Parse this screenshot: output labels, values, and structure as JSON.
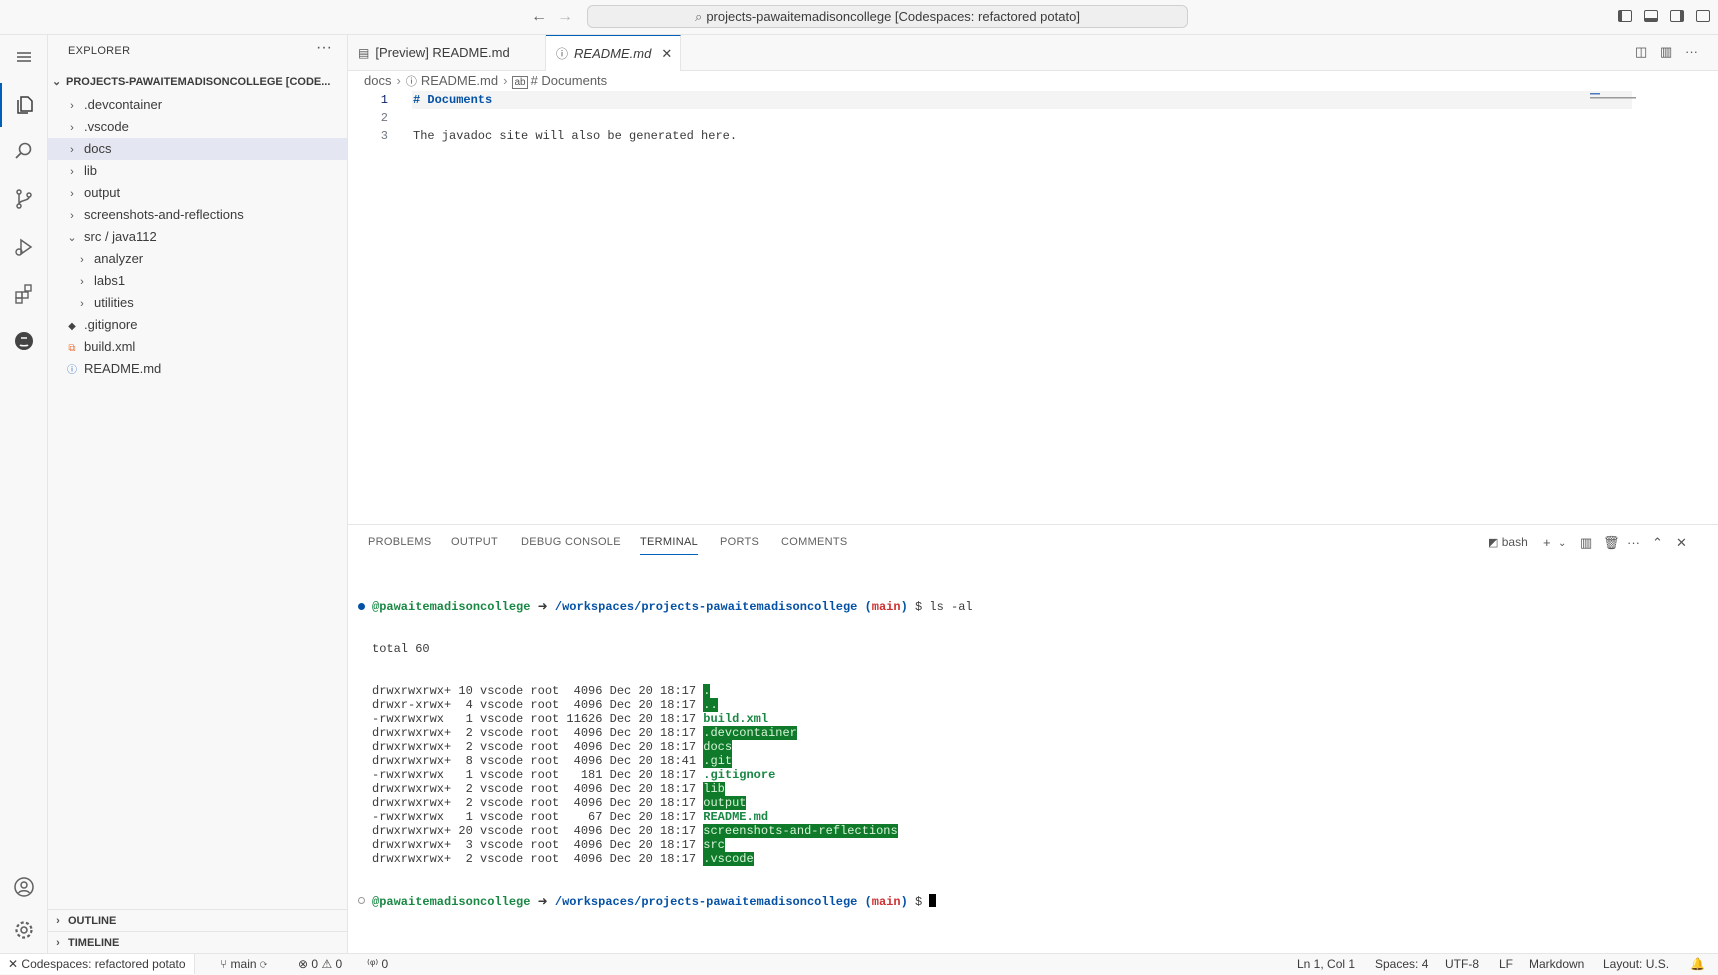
{
  "titlebar": {
    "command_center": "projects-pawaitemadisoncollege [Codespaces: refactored potato]"
  },
  "sidebar": {
    "title": "EXPLORER",
    "root": "PROJECTS-PAWAITEMADISONCOLLEGE [CODE...",
    "items": [
      {
        "label": ".devcontainer",
        "type": "folder",
        "expanded": false
      },
      {
        "label": ".vscode",
        "type": "folder",
        "expanded": false
      },
      {
        "label": "docs",
        "type": "folder",
        "expanded": false,
        "selected": true
      },
      {
        "label": "lib",
        "type": "folder",
        "expanded": false
      },
      {
        "label": "output",
        "type": "folder",
        "expanded": false
      },
      {
        "label": "screenshots-and-reflections",
        "type": "folder",
        "expanded": false
      },
      {
        "label": "src / java112",
        "type": "folder",
        "expanded": true
      },
      {
        "label": "analyzer",
        "type": "folder",
        "expanded": false,
        "indent": 1
      },
      {
        "label": "labs1",
        "type": "folder",
        "expanded": false,
        "indent": 1
      },
      {
        "label": "utilities",
        "type": "folder",
        "expanded": false,
        "indent": 1
      },
      {
        "label": ".gitignore",
        "type": "file",
        "icon": "git-icon"
      },
      {
        "label": "build.xml",
        "type": "file",
        "icon": "rss-icon"
      },
      {
        "label": "README.md",
        "type": "file",
        "icon": "info-icon"
      }
    ],
    "outline": "OUTLINE",
    "timeline": "TIMELINE"
  },
  "tabs": [
    {
      "label": "[Preview] README.md",
      "active": false
    },
    {
      "label": "README.md",
      "active": true
    }
  ],
  "breadcrumb": [
    "docs",
    "README.md",
    "# Documents"
  ],
  "editor": {
    "lines": [
      {
        "num": "1",
        "text": "# Documents"
      },
      {
        "num": "2",
        "text": ""
      },
      {
        "num": "3",
        "text": "The javadoc site will also be generated here."
      }
    ]
  },
  "panel": {
    "tabs": [
      "PROBLEMS",
      "OUTPUT",
      "DEBUG CONSOLE",
      "TERMINAL",
      "PORTS",
      "COMMENTS"
    ],
    "active_tab": "TERMINAL",
    "shell": "bash",
    "prompt": {
      "user": "@pawaitemadisoncollege",
      "arrow": "➜",
      "path": "/workspaces/projects-pawaitemadisoncollege",
      "branch_open": "(",
      "branch": "main",
      "branch_close": ")",
      "dollar": "$",
      "command": "ls -al"
    },
    "total": "total 60",
    "listing": [
      {
        "meta": "drwxrwxrwx+ 10 vscode root  4096 Dec 20 18:17 ",
        "name": "."
      },
      {
        "meta": "drwxr-xrwx+  4 vscode root  4096 Dec 20 18:17 ",
        "name": ".."
      },
      {
        "meta": "-rwxrwxrwx   1 vscode root 11626 Dec 20 18:17 ",
        "name": "build.xml"
      },
      {
        "meta": "drwxrwxrwx+  2 vscode root  4096 Dec 20 18:17 ",
        "name": ".devcontainer"
      },
      {
        "meta": "drwxrwxrwx+  2 vscode root  4096 Dec 20 18:17 ",
        "name": "docs"
      },
      {
        "meta": "drwxrwxrwx+  8 vscode root  4096 Dec 20 18:41 ",
        "name": ".git"
      },
      {
        "meta": "-rwxrwxrwx   1 vscode root   181 Dec 20 18:17 ",
        "name": ".gitignore"
      },
      {
        "meta": "drwxrwxrwx+  2 vscode root  4096 Dec 20 18:17 ",
        "name": "lib"
      },
      {
        "meta": "drwxrwxrwx+  2 vscode root  4096 Dec 20 18:17 ",
        "name": "output"
      },
      {
        "meta": "-rwxrwxrwx   1 vscode root    67 Dec 20 18:17 ",
        "name": "README.md"
      },
      {
        "meta": "drwxrwxrwx+ 20 vscode root  4096 Dec 20 18:17 ",
        "name": "screenshots-and-reflections"
      },
      {
        "meta": "drwxrwxrwx+  3 vscode root  4096 Dec 20 18:17 ",
        "name": "src"
      },
      {
        "meta": "drwxrwxrwx+  2 vscode root  4096 Dec 20 18:17 ",
        "name": ".vscode"
      }
    ]
  },
  "statusbar": {
    "remote": "Codespaces: refactored potato",
    "branch": "main",
    "errors": "0",
    "warnings": "0",
    "ports": "0",
    "position": "Ln 1, Col 1",
    "spaces": "Spaces: 4",
    "encoding": "UTF-8",
    "eol": "LF",
    "language": "Markdown",
    "layout": "Layout: U.S."
  },
  "colors": {
    "accent": "#005fb8",
    "terminal_green": "#198844",
    "terminal_blue": "#0451a5",
    "terminal_red": "#cd3131",
    "dir_highlight": "#0e7a2a"
  }
}
